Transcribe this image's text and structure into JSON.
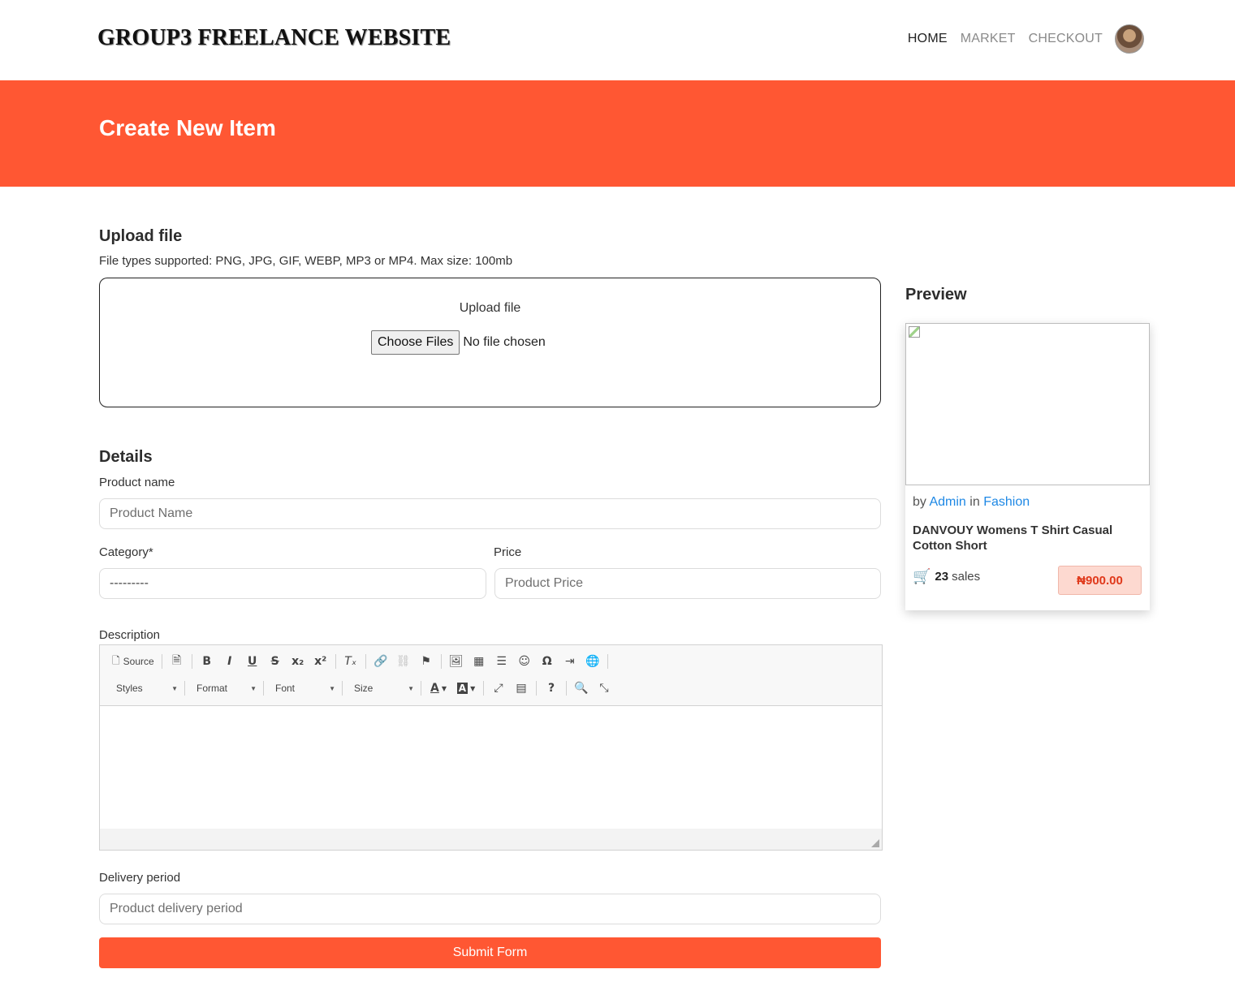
{
  "header": {
    "brand": "GROUP3 FREELANCE WEBSITE",
    "nav": [
      {
        "label": "HOME",
        "active": true
      },
      {
        "label": "MARKET",
        "active": false
      },
      {
        "label": "CHECKOUT",
        "active": false
      }
    ],
    "avatar_icon": "user-avatar"
  },
  "banner": {
    "title": "Create New Item",
    "color": "#ff5733"
  },
  "upload": {
    "heading": "Upload file",
    "note": "File types supported: PNG, JPG, GIF, WEBP, MP3 or MP4. Max size: 100mb",
    "dropzone_label": "Upload file",
    "choose_button": "Choose Files",
    "file_status": "No file chosen"
  },
  "details": {
    "heading": "Details",
    "product_name": {
      "label": "Product name",
      "placeholder": "Product Name",
      "value": ""
    },
    "category": {
      "label": "Category*",
      "selected": "---------"
    },
    "price": {
      "label": "Price",
      "placeholder": "Product Price",
      "value": ""
    },
    "description": {
      "label": "Description"
    },
    "delivery": {
      "label": "Delivery period",
      "placeholder": "Product delivery period",
      "value": ""
    },
    "submit": "Submit Form"
  },
  "editor": {
    "source_label": "Source",
    "combos": [
      "Styles",
      "Format",
      "Font",
      "Size"
    ],
    "row1_icons": [
      "source-icon",
      "templates-icon",
      "bold-icon",
      "italic-icon",
      "underline-icon",
      "strike-icon",
      "subscript-icon",
      "superscript-icon",
      "remove-format-icon",
      "link-icon",
      "unlink-icon",
      "anchor-icon",
      "image-icon",
      "table-icon",
      "horizontal-rule-icon",
      "smiley-icon",
      "special-char-icon",
      "page-break-icon",
      "iframe-icon"
    ],
    "row2_icons": [
      "text-color-icon",
      "bg-color-icon",
      "maximize-icon",
      "show-blocks-icon",
      "about-icon",
      "preview-icon",
      "fullscreen-icon"
    ]
  },
  "preview": {
    "heading": "Preview",
    "by_text": "by",
    "author": "Admin",
    "in_text": "in",
    "category": "Fashion",
    "title": "DANVOUY Womens T Shirt Casual Cotton Short",
    "sales_count": "23",
    "sales_text": "sales",
    "price": "₦900.00",
    "link_color": "#1e88e5",
    "price_color": "#e0391b"
  }
}
